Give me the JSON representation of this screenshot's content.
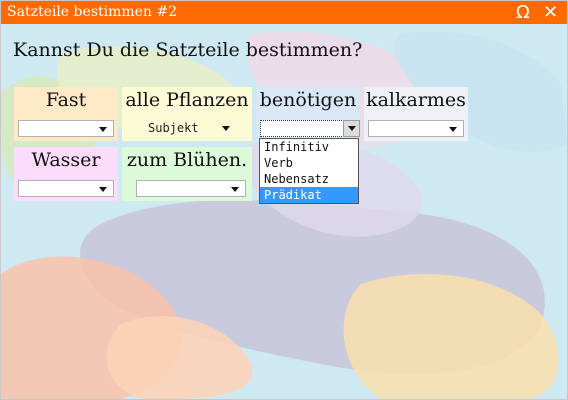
{
  "window": {
    "title": "Satzteile bestimmen #2",
    "omega_glyph": "Ω",
    "close_glyph": "✕"
  },
  "question": "Kannst Du die Satzteile bestimmen?",
  "cards": [
    {
      "word": "Fast",
      "selected": ""
    },
    {
      "word": "alle Pflanzen",
      "selected": "Subjekt"
    },
    {
      "word": "benötigen",
      "selected": ""
    },
    {
      "word": "kalkarmes",
      "selected": ""
    },
    {
      "word": "Wasser",
      "selected": ""
    },
    {
      "word": "zum Blühen.",
      "selected": ""
    }
  ],
  "dropdown_options": [
    "Infinitiv",
    "Verb",
    "Nebensatz",
    "Prädikat"
  ],
  "highlighted_option": "Prädikat",
  "colors": {
    "titlebar": "#ff6a00",
    "background": "#cfe9f3",
    "card_fast": "#fde9c6",
    "card_pflanzen": "#fbfbd6",
    "card_benoetigen": "#d9e8f7",
    "card_kalkarmes": "#eef0f6",
    "card_wasser": "#fbdcfb",
    "card_bluehen": "#dcfad9",
    "highlight": "#3399ff"
  }
}
